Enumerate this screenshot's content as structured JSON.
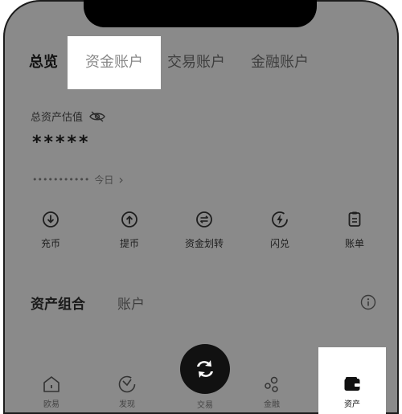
{
  "tabs": {
    "overview": "总览",
    "funding": "资金账户",
    "trade": "交易账户",
    "finance": "金融账户"
  },
  "balance": {
    "label": "总资产估值",
    "masked_value": "*****",
    "masked_pnl": "•••••••••••",
    "period": "今日",
    "chevron": "›"
  },
  "actions": [
    {
      "label": "充币",
      "icon": "deposit-icon"
    },
    {
      "label": "提币",
      "icon": "withdraw-icon"
    },
    {
      "label": "资金划转",
      "icon": "transfer-icon"
    },
    {
      "label": "闪兑",
      "icon": "flash-swap-icon"
    },
    {
      "label": "账单",
      "icon": "bill-icon"
    }
  ],
  "portfolio": {
    "title": "资产组合",
    "account": "账户"
  },
  "bottom_nav": [
    {
      "label": "欧易",
      "icon": "home-icon"
    },
    {
      "label": "发现",
      "icon": "discover-icon"
    },
    {
      "label": "交易",
      "icon": "swap-icon"
    },
    {
      "label": "金融",
      "icon": "finance-icon"
    },
    {
      "label": "资产",
      "icon": "wallet-icon"
    }
  ]
}
